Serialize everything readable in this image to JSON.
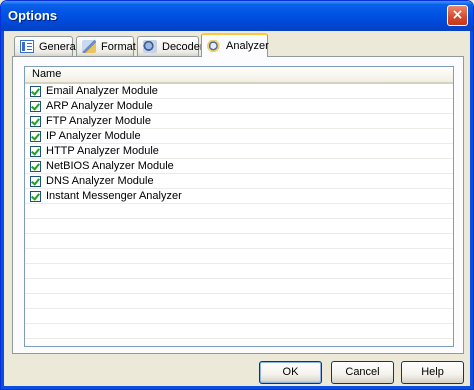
{
  "window": {
    "title": "Options",
    "close_glyph": "×"
  },
  "tabs": [
    {
      "label": "General",
      "icon": "general-icon",
      "active": false
    },
    {
      "label": "Format",
      "icon": "format-icon",
      "active": false
    },
    {
      "label": "Decoder",
      "icon": "decoder-icon",
      "active": false
    },
    {
      "label": "Analyzer",
      "icon": "analyzer-icon",
      "active": true
    }
  ],
  "list": {
    "column_header": "Name",
    "items": [
      {
        "label": "Email Analyzer Module",
        "checked": true
      },
      {
        "label": "ARP Analyzer Module",
        "checked": true
      },
      {
        "label": "FTP Analyzer Module",
        "checked": true
      },
      {
        "label": "IP Analyzer Module",
        "checked": true
      },
      {
        "label": "HTTP Analyzer Module",
        "checked": true
      },
      {
        "label": "NetBIOS Analyzer Module",
        "checked": true
      },
      {
        "label": "DNS Analyzer Module",
        "checked": true
      },
      {
        "label": "Instant Messenger Analyzer",
        "checked": true
      }
    ]
  },
  "buttons": {
    "ok": "OK",
    "cancel": "Cancel",
    "help": "Help"
  }
}
